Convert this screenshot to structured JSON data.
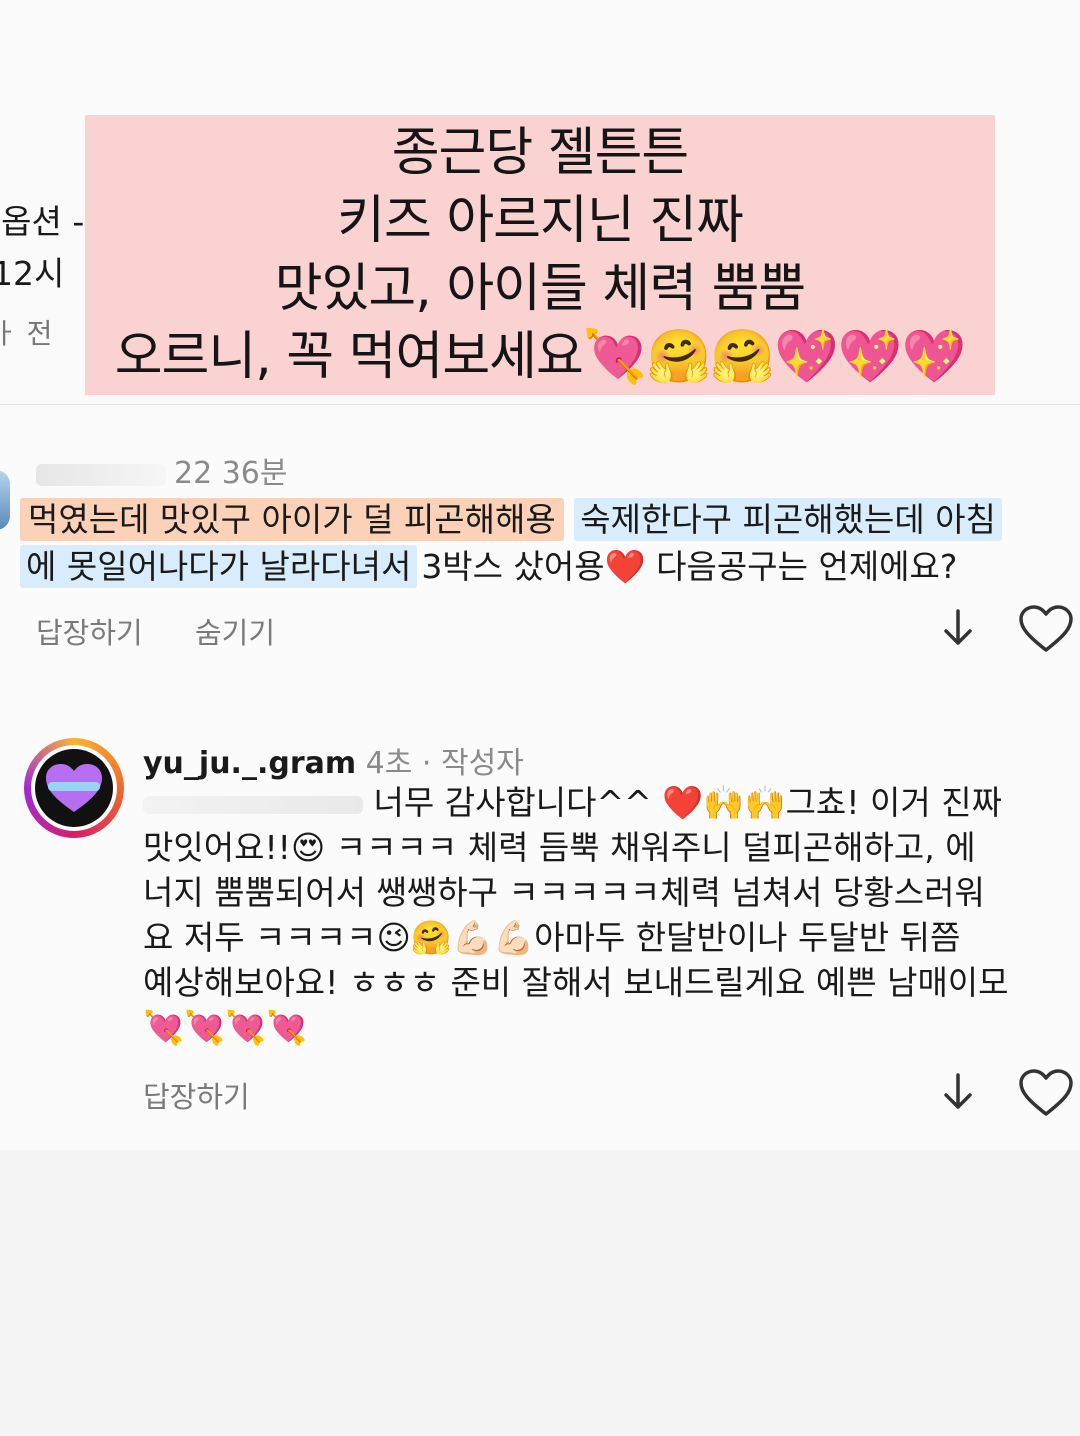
{
  "left_peek": {
    "line1": "l옵션 -",
    "line2": "12시",
    "line3": "ㅏ 전"
  },
  "caption": {
    "lines": [
      "종근당 젤튼튼",
      "키즈 아르지닌 진짜",
      "맛있고, 아이들 체력 뿜뿜",
      "오르니, 꼭 먹여보세요💘🤗🤗💖💖💖"
    ]
  },
  "comment1": {
    "meta": "22 36분",
    "highlight_orange": "먹였는데 맛있구 아이가 덜 피곤해해용",
    "highlight_blue_1": "숙제한다구 피곤해했는데 아침",
    "highlight_blue_2": "에  못일어나다가 날라다녀서",
    "plain_tail": "3박스 샀어용❤️ 다음공구는 언제에요?",
    "reply_label": "답장하기",
    "hide_label": "숨기기"
  },
  "comment2": {
    "username": "yu_ju._.gram",
    "time": "4초",
    "author_tag": "· 작성자",
    "lines": [
      "너무 감사합니다^^ ❤️🙌🙌그쵸! 이거 진짜",
      "맛잇어요!!😍 ㅋㅋㅋㅋ 체력 듬뿍 채워주니 덜피곤해하고, 에",
      "너지 뿜뿜되어서 쌩쌩하구 ㅋㅋㅋㅋㅋ체력 넘쳐서 당황스러워",
      "요 저두 ㅋㅋㅋㅋ😉🤗💪🏻💪🏻아마두 한달반이나 두달반 뒤쯤",
      "예상해보아요! ㅎㅎㅎ 준비 잘해서 보내드릴게요 예쁜 남매이모",
      "💘💘💘💘"
    ],
    "reply_label": "답장하기"
  },
  "icons": {
    "download": "download-arrow-icon",
    "like": "heart-outline-icon",
    "avatar_logo": "purple-heart-logo"
  },
  "colors": {
    "caption_bg": "#fbd2d2",
    "highlight_orange": "#fbd2b7",
    "highlight_blue": "#d8ecfb",
    "logo_purple": "#b76ef0"
  }
}
